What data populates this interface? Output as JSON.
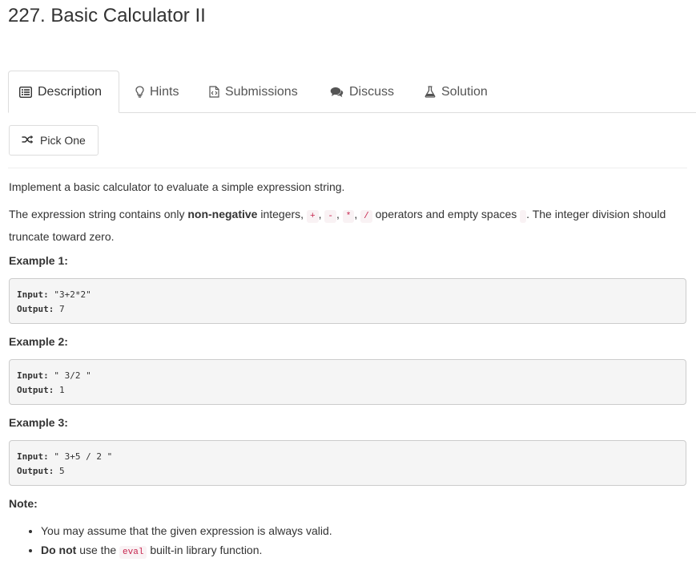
{
  "problem": {
    "title": "227. Basic Calculator II"
  },
  "tabs": [
    {
      "label": "Description",
      "icon": "description-icon",
      "active": true
    },
    {
      "label": "Hints",
      "icon": "lightbulb-icon"
    },
    {
      "label": "Submissions",
      "icon": "submissions-icon"
    },
    {
      "label": "Discuss",
      "icon": "comments-icon"
    },
    {
      "label": "Solution",
      "icon": "flask-icon"
    }
  ],
  "pick_one": {
    "label": "Pick One",
    "icon": "shuffle-icon"
  },
  "description": {
    "intro": "Implement a basic calculator to evaluate a simple expression string.",
    "p2_a": "The expression string contains only ",
    "p2_bold": "non-negative",
    "p2_b": " integers, ",
    "op_plus": "+",
    "op_minus": "-",
    "op_mult": "*",
    "op_div": "/",
    "sep": ", ",
    "p2_c": " operators and empty spaces ",
    "space_code": " ",
    "p2_d": ". The integer division should truncate toward zero."
  },
  "examples": [
    {
      "heading": "Example 1:",
      "input_label": "Input:",
      "input": " \"3+2*2\"",
      "output_label": "Output:",
      "output": " 7"
    },
    {
      "heading": "Example 2:",
      "input_label": "Input:",
      "input": " \" 3/2 \"",
      "output_label": "Output:",
      "output": " 1"
    },
    {
      "heading": "Example 3:",
      "input_label": "Input:",
      "input": " \" 3+5 / 2 \"",
      "output_label": "Output:",
      "output": " 5"
    }
  ],
  "note": {
    "heading": "Note:",
    "item1": "You may assume that the given expression is always valid.",
    "item2_bold": "Do not",
    "item2_a": " use the ",
    "item2_code": "eval",
    "item2_b": " built-in library function."
  }
}
